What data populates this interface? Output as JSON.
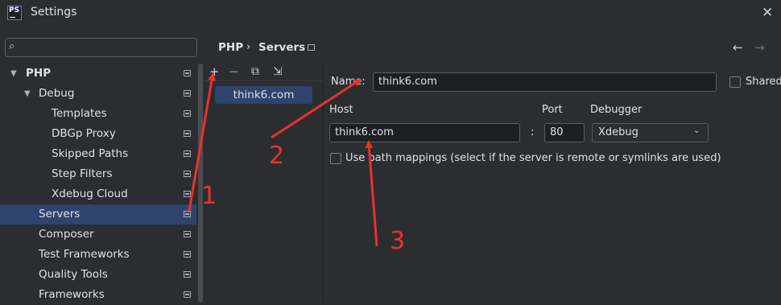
{
  "window": {
    "title": "Settings",
    "logo_text": "PS"
  },
  "search": {
    "placeholder": ""
  },
  "sidebar": {
    "items": [
      {
        "label": "PHP",
        "expanded": true
      },
      {
        "label": "Debug",
        "expanded": true
      },
      {
        "label": "Templates"
      },
      {
        "label": "DBGp Proxy"
      },
      {
        "label": "Skipped Paths"
      },
      {
        "label": "Step Filters"
      },
      {
        "label": "Xdebug Cloud"
      },
      {
        "label": "Servers",
        "selected": true
      },
      {
        "label": "Composer"
      },
      {
        "label": "Test Frameworks"
      },
      {
        "label": "Quality Tools"
      },
      {
        "label": "Frameworks"
      }
    ]
  },
  "breadcrumb": {
    "parent": "PHP",
    "separator": "›",
    "current": "Servers"
  },
  "toolbar": {
    "add": "+",
    "remove": "—",
    "copy": "⧉",
    "import": "⇲"
  },
  "servers": {
    "items": [
      "think6.com"
    ]
  },
  "form": {
    "name_label": "Name:",
    "name_value": "think6.com",
    "shared_label": "Shared",
    "host_label": "Host",
    "host_value": "think6.com",
    "colon": ":",
    "port_label": "Port",
    "port_value": "80",
    "debugger_label": "Debugger",
    "debugger_value": "Xdebug",
    "path_mappings_label": "Use path mappings (select if the server is remote or symlinks are used)"
  },
  "annotations": {
    "one": "1",
    "two": "2",
    "three": "3",
    "color": "#e8322a"
  },
  "colors": {
    "background": "#2b2d30",
    "selection": "#2e436e",
    "field": "#1e1f22"
  }
}
